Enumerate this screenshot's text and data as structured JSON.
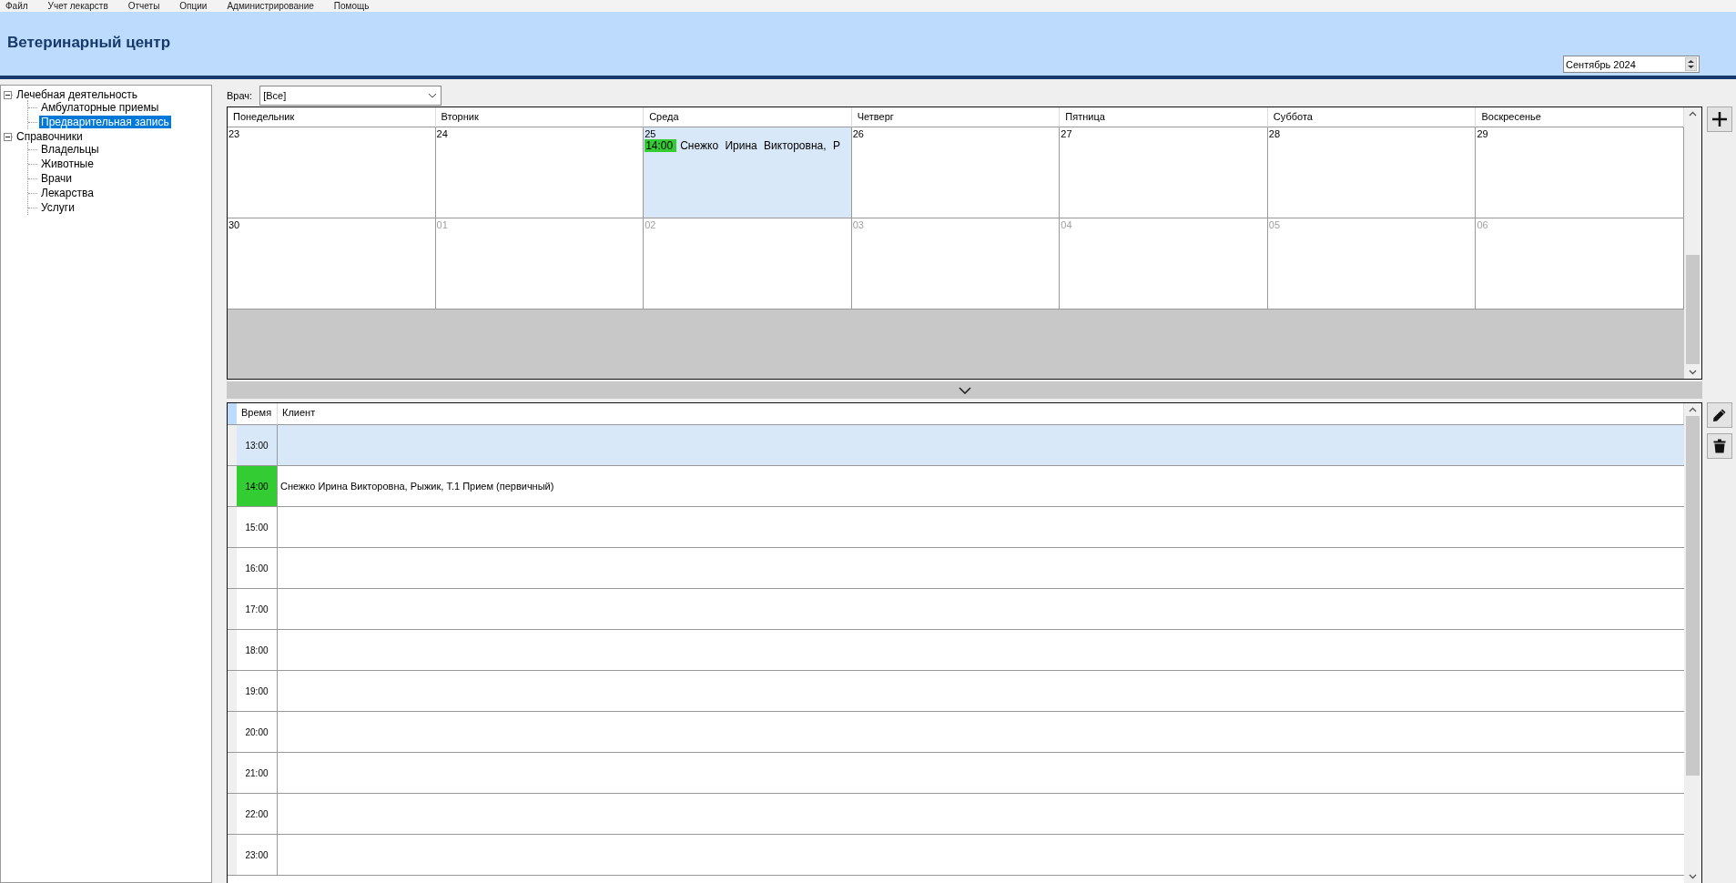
{
  "menu": [
    "Файл",
    "Учет лекарств",
    "Отчеты",
    "Опции",
    "Администрирование",
    "Помощь"
  ],
  "header": {
    "title": "Ветеринарный центр",
    "month": "Сентябрь 2024"
  },
  "tree": [
    {
      "label": "Лечебная деятельность",
      "expanded": true,
      "selected": false,
      "children": [
        {
          "label": "Амбулаторные приемы",
          "selected": false
        },
        {
          "label": "Предварительная запись",
          "selected": true
        }
      ]
    },
    {
      "label": "Справочники",
      "expanded": true,
      "selected": false,
      "children": [
        {
          "label": "Владельцы",
          "selected": false
        },
        {
          "label": "Животные",
          "selected": false
        },
        {
          "label": "Врачи",
          "selected": false
        },
        {
          "label": "Лекарства",
          "selected": false
        },
        {
          "label": "Услуги",
          "selected": false
        }
      ]
    }
  ],
  "doctor_filter": {
    "label": "Врач:",
    "value": "[Все]"
  },
  "calendar": {
    "weekdays": [
      "Понедельник",
      "Вторник",
      "Среда",
      "Четверг",
      "Пятница",
      "Суббота",
      "Воскресенье"
    ],
    "weeks": [
      [
        {
          "day": "23",
          "other_month": false,
          "selected": false
        },
        {
          "day": "24",
          "other_month": false,
          "selected": false
        },
        {
          "day": "25",
          "other_month": false,
          "selected": true,
          "events": [
            {
              "time": "14:00",
              "text": "Снежко Ирина Викторовна, Р"
            }
          ]
        },
        {
          "day": "26",
          "other_month": false,
          "selected": false
        },
        {
          "day": "27",
          "other_month": false,
          "selected": false
        },
        {
          "day": "28",
          "other_month": false,
          "selected": false
        },
        {
          "day": "29",
          "other_month": false,
          "selected": false
        }
      ],
      [
        {
          "day": "30",
          "other_month": false,
          "selected": false
        },
        {
          "day": "01",
          "other_month": true,
          "selected": false
        },
        {
          "day": "02",
          "other_month": true,
          "selected": false
        },
        {
          "day": "03",
          "other_month": true,
          "selected": false
        },
        {
          "day": "04",
          "other_month": true,
          "selected": false
        },
        {
          "day": "05",
          "other_month": true,
          "selected": false
        },
        {
          "day": "06",
          "other_month": true,
          "selected": false
        }
      ]
    ]
  },
  "schedule": {
    "columns": [
      "Время",
      "Клиент"
    ],
    "rows": [
      {
        "time": "13:00",
        "client": "",
        "selected": true,
        "booked": false
      },
      {
        "time": "14:00",
        "client": "Снежко Ирина Викторовна, Рыжик, Т.1 Прием (первичный)",
        "selected": false,
        "booked": true
      },
      {
        "time": "15:00",
        "client": "",
        "selected": false,
        "booked": false
      },
      {
        "time": "16:00",
        "client": "",
        "selected": false,
        "booked": false
      },
      {
        "time": "17:00",
        "client": "",
        "selected": false,
        "booked": false
      },
      {
        "time": "18:00",
        "client": "",
        "selected": false,
        "booked": false
      },
      {
        "time": "19:00",
        "client": "",
        "selected": false,
        "booked": false
      },
      {
        "time": "20:00",
        "client": "",
        "selected": false,
        "booked": false
      },
      {
        "time": "21:00",
        "client": "",
        "selected": false,
        "booked": false
      },
      {
        "time": "22:00",
        "client": "",
        "selected": false,
        "booked": false
      },
      {
        "time": "23:00",
        "client": "",
        "selected": false,
        "booked": false
      }
    ]
  }
}
